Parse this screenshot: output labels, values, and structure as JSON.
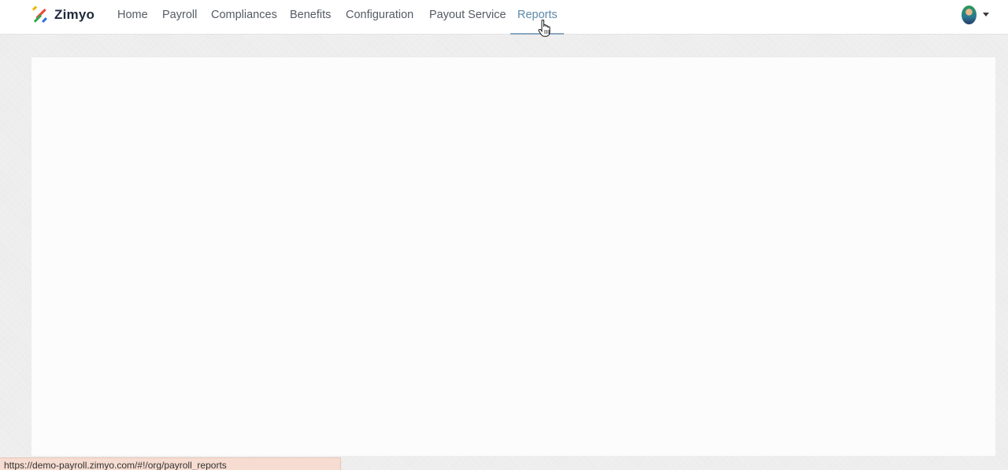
{
  "app": {
    "name": "Zimyo",
    "colors": {
      "brand_text": "#1f2a3c",
      "active_nav": "#5b8aa8",
      "nav_text": "#555a63"
    }
  },
  "nav": {
    "items": [
      {
        "label": "Home"
      },
      {
        "label": "Payroll"
      },
      {
        "label": "Compliances"
      },
      {
        "label": "Benefits"
      },
      {
        "label": "Configuration"
      },
      {
        "label": "Payout Service"
      },
      {
        "label": "Reports",
        "active": true
      }
    ]
  },
  "user_menu": {
    "avatar_icon": "user-avatar-icon",
    "dropdown_icon": "caret-down-icon"
  },
  "status_bar": {
    "url": "https://demo-payroll.zimyo.com/#!/org/payroll_reports"
  }
}
